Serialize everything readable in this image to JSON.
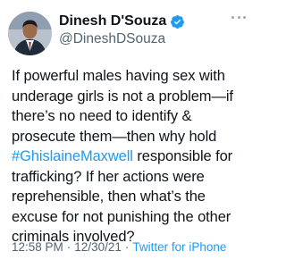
{
  "author": {
    "display_name": "Dinesh D'Souza",
    "handle": "@DineshDSouza",
    "verified": true
  },
  "tweet": {
    "line1": "If powerful males having sex with",
    "line2": "underage girls is not a problem—if",
    "line3": "there’s no need to identify &",
    "line4": "prosecute them—then why hold",
    "hashtag": "#GhislaineMaxwell",
    "line5_rest": " responsible for",
    "line6": "trafficking? If her actions were",
    "line7": "reprehensible, then what’s the",
    "line8": "excuse for not punishing the other",
    "line9": "criminals involved?"
  },
  "meta": {
    "time": "12:58 PM",
    "separator1": "·",
    "date": "12/30/21",
    "separator2": "·",
    "source": "Twitter for iPhone"
  },
  "colors": {
    "text": "#0f1419",
    "secondary": "#536471",
    "link": "#1d9bf0",
    "verified": "#1d9bf0"
  },
  "icons": {
    "avatar": "profile-photo",
    "verified": "verified-badge-icon",
    "more": "more-options-icon"
  }
}
